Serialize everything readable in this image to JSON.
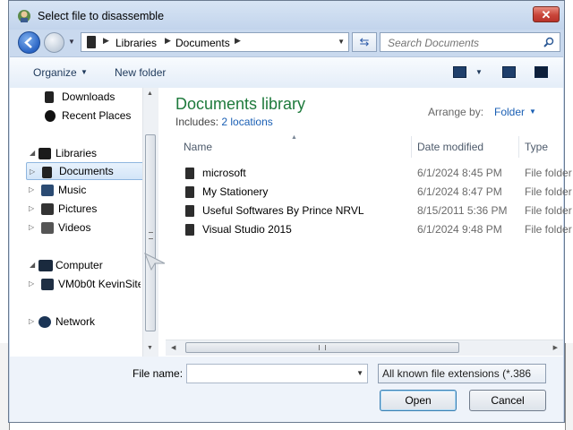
{
  "window": {
    "title": "Select file to disassemble",
    "close_label": "✕"
  },
  "address": {
    "crumbs": [
      "Libraries",
      "Documents"
    ]
  },
  "search": {
    "placeholder": "Search Documents"
  },
  "toolbar": {
    "organize_label": "Organize",
    "new_folder_label": "New folder"
  },
  "nav": {
    "items": [
      {
        "label": "Downloads"
      },
      {
        "label": "Recent Places"
      },
      {
        "label": "Libraries"
      },
      {
        "label": "Documents"
      },
      {
        "label": "Music"
      },
      {
        "label": "Pictures"
      },
      {
        "label": "Videos"
      },
      {
        "label": "Computer"
      },
      {
        "label": "VM0b0t KevinSite"
      },
      {
        "label": "Network"
      }
    ]
  },
  "library": {
    "title": "Documents library",
    "includes_prefix": "Includes:",
    "includes_link": "2 locations",
    "arrange_label": "Arrange by:",
    "arrange_value": "Folder"
  },
  "columns": {
    "name": "Name",
    "date": "Date modified",
    "type": "Type"
  },
  "files": [
    {
      "name": "microsoft",
      "date": "6/1/2024 8:45 PM",
      "type": "File folder"
    },
    {
      "name": "My Stationery",
      "date": "6/1/2024 8:47 PM",
      "type": "File folder"
    },
    {
      "name": "Useful Softwares By Prince NRVL",
      "date": "8/15/2011 5:36 PM",
      "type": "File folder"
    },
    {
      "name": "Visual Studio 2015",
      "date": "6/1/2024 9:48 PM",
      "type": "File folder"
    }
  ],
  "footer": {
    "filename_label": "File name:",
    "filename_value": "",
    "filter_value": "All known file extensions (*.386",
    "open_label": "Open",
    "cancel_label": "Cancel"
  }
}
